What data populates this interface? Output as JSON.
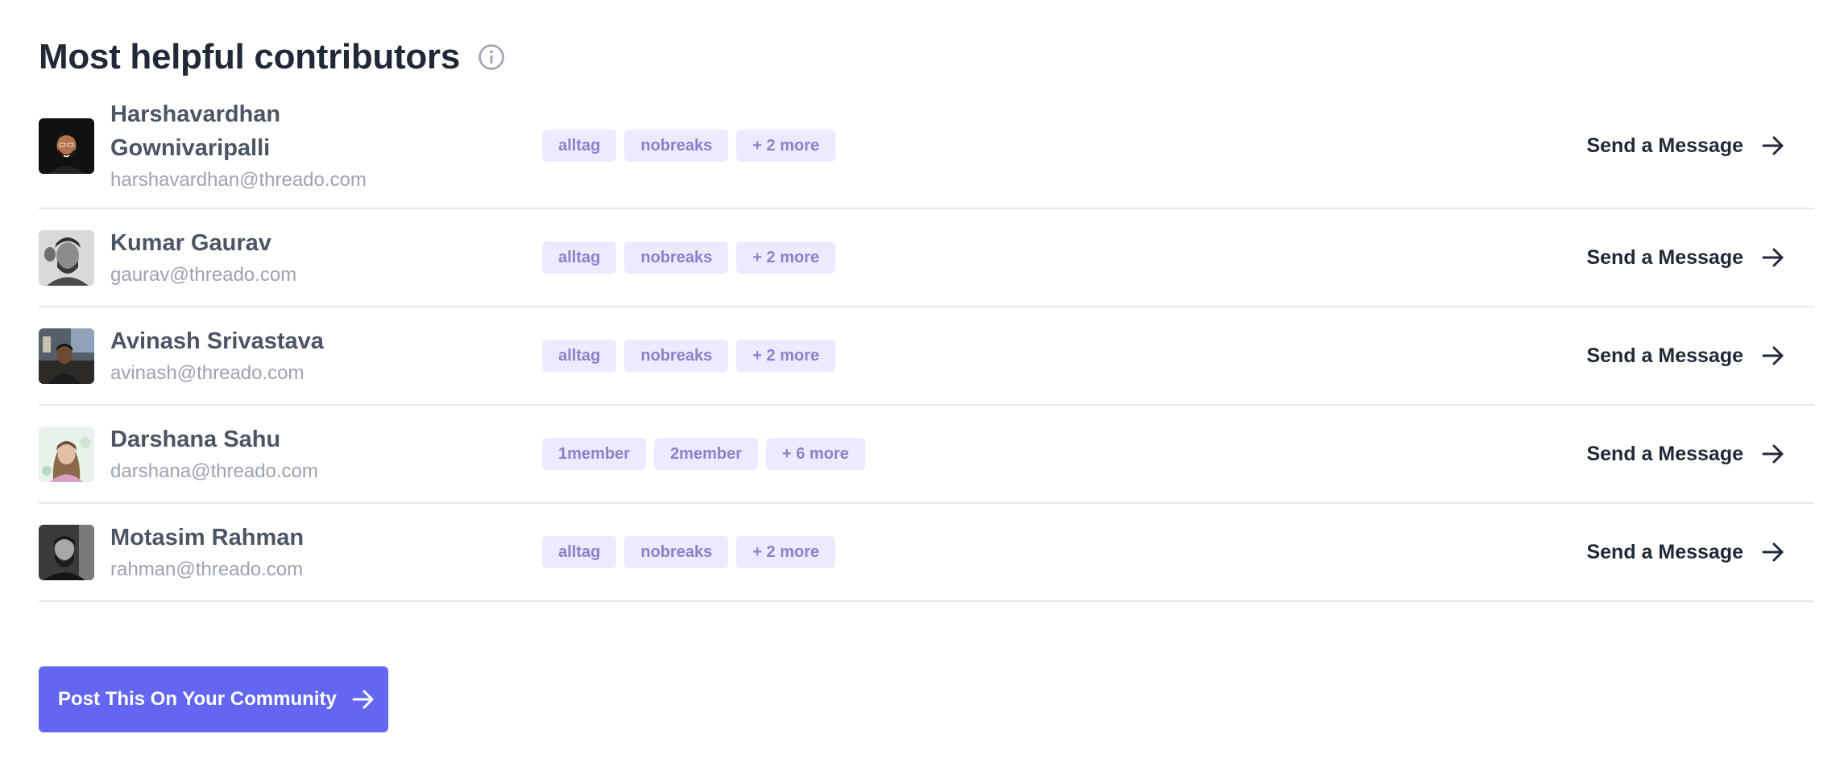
{
  "header": {
    "title": "Most helpful contributors"
  },
  "contributors": [
    {
      "name": "Harshavardhan Gownivaripalli",
      "email": "harshavardhan@threado.com",
      "tags": [
        "alltag",
        "nobreaks",
        "+ 2 more"
      ],
      "action": "Send a Message"
    },
    {
      "name": "Kumar Gaurav",
      "email": "gaurav@threado.com",
      "tags": [
        "alltag",
        "nobreaks",
        "+ 2 more"
      ],
      "action": "Send a Message"
    },
    {
      "name": "Avinash Srivastava",
      "email": "avinash@threado.com",
      "tags": [
        "alltag",
        "nobreaks",
        "+ 2 more"
      ],
      "action": "Send a Message"
    },
    {
      "name": "Darshana Sahu",
      "email": "darshana@threado.com",
      "tags": [
        "1member",
        "2member",
        "+ 6 more"
      ],
      "action": "Send a Message"
    },
    {
      "name": "Motasim Rahman",
      "email": "rahman@threado.com",
      "tags": [
        "alltag",
        "nobreaks",
        "+ 2 more"
      ],
      "action": "Send a Message"
    }
  ],
  "footer": {
    "post_button_label": "Post This On Your Community"
  },
  "colors": {
    "accent": "#6366f1",
    "tag_bg": "#ede9fe",
    "tag_text": "#8b82c9",
    "divider": "#e5e7eb"
  },
  "icons": {
    "info": "info-icon",
    "arrow": "arrow-right-icon"
  }
}
